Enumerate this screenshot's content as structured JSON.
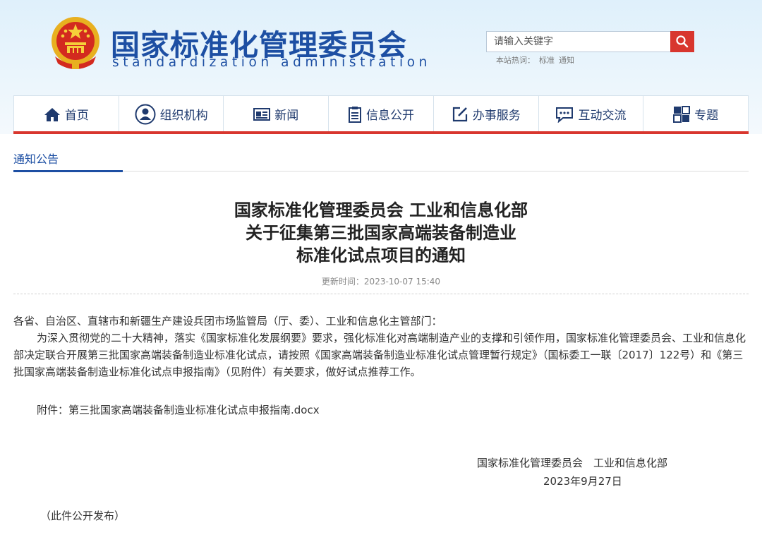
{
  "header": {
    "site_title": "国家标准化管理委员会",
    "site_subtitle": "standardization administration",
    "search_placeholder": "请输入关键字",
    "hot_label": "本站热词：",
    "hot_words": [
      "标准",
      "通知"
    ]
  },
  "nav": {
    "items": [
      {
        "label": "首页",
        "icon": "home-icon"
      },
      {
        "label": "组织机构",
        "icon": "person-icon"
      },
      {
        "label": "新闻",
        "icon": "newspaper-icon"
      },
      {
        "label": "信息公开",
        "icon": "clipboard-icon"
      },
      {
        "label": "办事服务",
        "icon": "edit-icon"
      },
      {
        "label": "互动交流",
        "icon": "chat-icon"
      },
      {
        "label": "专题",
        "icon": "topic-icon"
      }
    ]
  },
  "breadcrumb": {
    "label": "通知公告"
  },
  "article": {
    "title_lines": [
      "国家标准化管理委员会 工业和信息化部",
      "关于征集第三批国家高端装备制造业",
      "标准化试点项目的通知"
    ],
    "updated": "更新时间：2023-10-07 15:40",
    "salutation": "各省、自治区、直辖市和新疆生产建设兵团市场监管局（厅、委）、工业和信息化主管部门：",
    "paragraph": "为深入贯彻党的二十大精神，落实《国家标准化发展纲要》要求，强化标准化对高端制造产业的支撑和引领作用，国家标准化管理委员会、工业和信息化部决定联合开展第三批国家高端装备制造业标准化试点，请按照《国家高端装备制造业标准化试点管理暂行规定》（国标委工一联〔2017〕122号）和《第三批国家高端装备制造业标准化试点申报指南》（见附件）有关要求，做好试点推荐工作。",
    "attachment_label": "附件：",
    "attachment_file": "第三批国家高端装备制造业标准化试点申报指南.docx",
    "signature_org": "国家标准化管理委员会　工业和信息化部",
    "signature_date": "2023年9月27日",
    "note": "（此件公开发布）"
  },
  "colors": {
    "brand_blue": "#1d4fa3",
    "accent_red": "#d8362e"
  }
}
